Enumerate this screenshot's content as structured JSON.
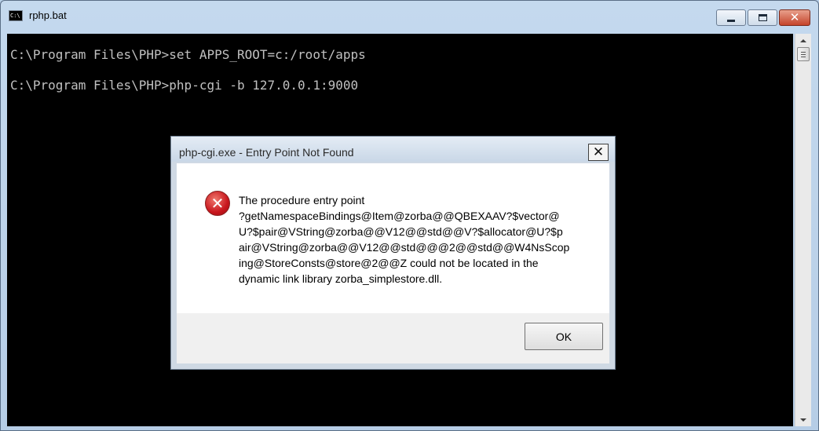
{
  "window": {
    "title": "rphp.bat",
    "icon": "console-icon"
  },
  "console": {
    "lines": [
      "C:\\Program Files\\PHP>set APPS_ROOT=c:/root/apps",
      "C:\\Program Files\\PHP>php-cgi -b 127.0.0.1:9000"
    ],
    "background": "#000000",
    "foreground": "#c0c0c0"
  },
  "dialog": {
    "title": "php-cgi.exe - Entry Point Not Found",
    "icon": "error-icon",
    "message_lines": [
      "The procedure entry point",
      "?getNamespaceBindings@Item@zorba@@QBEXAAV?$vector@",
      "U?$pair@VString@zorba@@V12@@std@@V?$allocator@U?$p",
      "air@VString@zorba@@V12@@std@@@2@@std@@W4NsScop",
      "ing@StoreConsts@store@2@@Z could not be located in the",
      "dynamic link library zorba_simplestore.dll."
    ],
    "ok_label": "OK"
  }
}
